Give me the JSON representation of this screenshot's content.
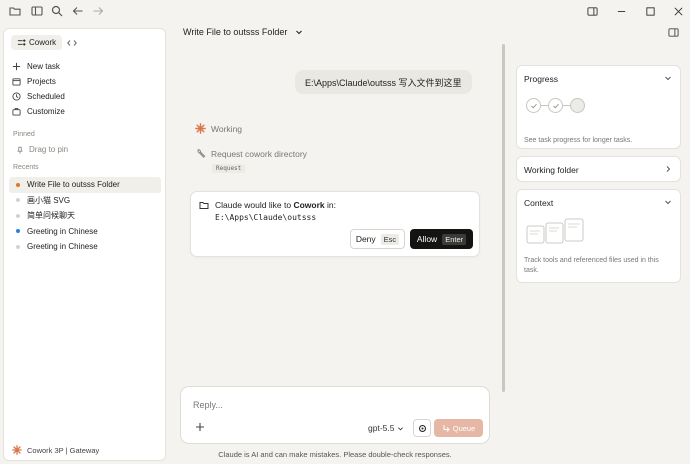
{
  "titlebar": {
    "icons": [
      "folder-icon",
      "sidebar-icon",
      "search-icon",
      "back-arrow-icon",
      "forward-arrow-icon"
    ],
    "window_controls": [
      "split-view-icon",
      "minimize-icon",
      "maximize-icon",
      "close-icon"
    ]
  },
  "sidebar": {
    "mode": {
      "label": "Cowork",
      "alt_icon": "code-icon"
    },
    "nav": [
      {
        "label": "New task",
        "icon": "plus-icon"
      },
      {
        "label": "Projects",
        "icon": "folder-icon"
      },
      {
        "label": "Scheduled",
        "icon": "clock-icon"
      },
      {
        "label": "Customize",
        "icon": "briefcase-icon"
      }
    ],
    "pinned_title": "Pinned",
    "pin_hint": "Drag to pin",
    "recents_title": "Recents",
    "recents": [
      {
        "label": "Write File to outsss Folder",
        "dot_color": "#e0772d",
        "active": true
      },
      {
        "label": "画小猫 SVG",
        "dot_color": "#cfd4da",
        "active": false
      },
      {
        "label": "简单问候聊天",
        "dot_color": "#cfd4da",
        "active": false
      },
      {
        "label": "Greeting in Chinese",
        "dot_color": "#2f7de1",
        "active": false
      },
      {
        "label": "Greeting in Chinese",
        "dot_color": "#cfd4da",
        "active": false
      }
    ],
    "footer": "Cowork 3P | Gateway"
  },
  "main": {
    "title": "Write File to outsss Folder",
    "user_message": "E:\\Apps\\Claude\\outsss 写入文件到这里",
    "status": "Working",
    "tool_call": "Request cowork directory",
    "tool_tag": "Request",
    "permission": {
      "prefix": "Claude would like to ",
      "app": "Cowork",
      "suffix": " in:",
      "path": "E:\\Apps\\Claude\\outsss",
      "deny_label": "Deny",
      "deny_key": "Esc",
      "allow_label": "Allow",
      "allow_key": "Enter"
    },
    "composer": {
      "placeholder": "Reply...",
      "model": "gpt-5.5",
      "queue_label": "Queue"
    },
    "disclaimer": "Claude is AI and can make mistakes. Please double-check responses."
  },
  "right_panel": {
    "progress": {
      "title": "Progress",
      "desc": "See task progress for longer tasks.",
      "steps": [
        "done",
        "done",
        "pending"
      ]
    },
    "working_folder": {
      "title": "Working folder"
    },
    "context": {
      "title": "Context",
      "desc": "Track tools and referenced files used in this task."
    }
  },
  "colors": {
    "accent": "#d9774b",
    "queue_button": "#e7b7a5",
    "allow_button": "#141413"
  }
}
